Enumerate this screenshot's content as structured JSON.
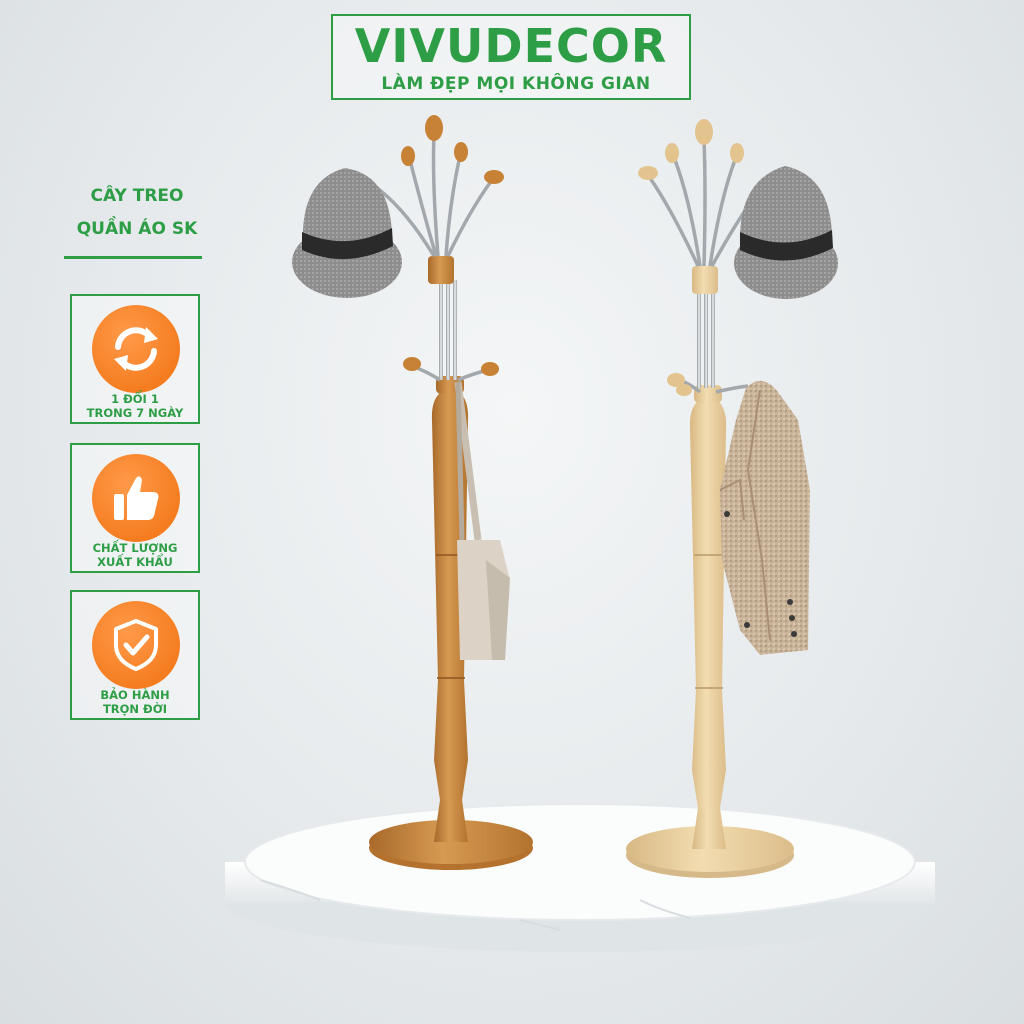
{
  "brand": {
    "name": "VIVUDECOR",
    "slogan": "LÀM ĐẸP MỌI KHÔNG GIAN"
  },
  "product": {
    "title_line1": "CÂY TREO",
    "title_line2": "QUẦN ÁO SK"
  },
  "badges": [
    {
      "icon": "exchange-arrows-icon",
      "line1": "1 ĐỔI 1",
      "line2": "TRONG 7 NGÀY"
    },
    {
      "icon": "thumbs-up-icon",
      "line1": "CHẤT LƯỢNG",
      "line2": "XUẤT KHẨU"
    },
    {
      "icon": "shield-check-icon",
      "line1": "BẢO HÀNH",
      "line2": "TRỌN ĐỜI"
    }
  ],
  "colors": {
    "brand_green": "#2e9e46",
    "badge_orange": "#f57d20",
    "dark_wood": "#c98a3f",
    "light_wood": "#e8cf9e"
  }
}
